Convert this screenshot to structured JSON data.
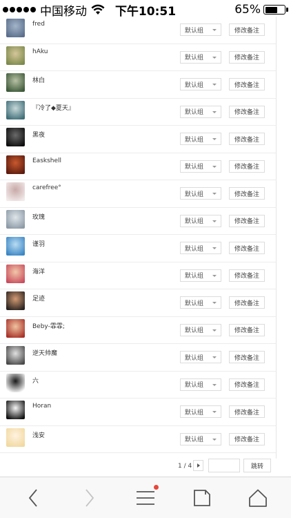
{
  "status_bar": {
    "carrier": "中国移动",
    "time": "下午10:51",
    "battery": "65%",
    "battery_level": 0.65
  },
  "friends": [
    {
      "name": "fred",
      "group": "默认组",
      "remark": "修改备注",
      "avatar_colors": [
        "#5a6e8c",
        "#a3b5c8"
      ]
    },
    {
      "name": "hAku",
      "group": "默认组",
      "remark": "修改备注",
      "avatar_colors": [
        "#7c8a4c",
        "#d5c69a"
      ]
    },
    {
      "name": "林白",
      "group": "默认组",
      "remark": "修改备注",
      "avatar_colors": [
        "#3e5a3a",
        "#b7c1a4"
      ]
    },
    {
      "name": "『冷了◆夏天』",
      "group": "默认组",
      "remark": "修改备注",
      "avatar_colors": [
        "#3f6e78",
        "#c6d8d8"
      ]
    },
    {
      "name": "黑夜",
      "group": "默认组",
      "remark": "修改备注",
      "avatar_colors": [
        "#0d0d0d",
        "#6a6a6a"
      ]
    },
    {
      "name": "Easkshell",
      "group": "默认组",
      "remark": "修改备注",
      "avatar_colors": [
        "#5c1c0e",
        "#c8582e"
      ]
    },
    {
      "name": "carefree°",
      "group": "默认组",
      "remark": "修改备注",
      "avatar_colors": [
        "#f2e9e9",
        "#c7aaa8"
      ]
    },
    {
      "name": "玫瑰",
      "group": "默认组",
      "remark": "修改备注",
      "avatar_colors": [
        "#8c9aa6",
        "#e0e6ea"
      ]
    },
    {
      "name": "谨羽",
      "group": "默认组",
      "remark": "修改备注",
      "avatar_colors": [
        "#3b86c4",
        "#b9dcf2"
      ]
    },
    {
      "name": "海洋",
      "group": "默认组",
      "remark": "修改备注",
      "avatar_colors": [
        "#c94e5e",
        "#f2c7a8"
      ]
    },
    {
      "name": "足迹",
      "group": "默认组",
      "remark": "修改备注",
      "avatar_colors": [
        "#2a2420",
        "#d39a74"
      ]
    },
    {
      "name": "Beby-霏霏;",
      "group": "默认组",
      "remark": "修改备注",
      "avatar_colors": [
        "#a8322a",
        "#f0c3a0"
      ]
    },
    {
      "name": "逆天帅魔",
      "group": "默认组",
      "remark": "修改备注",
      "avatar_colors": [
        "#4a4a4a",
        "#e0e0e0"
      ]
    },
    {
      "name": "六",
      "group": "默认组",
      "remark": "修改备注",
      "avatar_colors": [
        "#ffffff",
        "#1a1a1a"
      ]
    },
    {
      "name": "Horan",
      "group": "默认组",
      "remark": "修改备注",
      "avatar_colors": [
        "#111111",
        "#f5f5f5"
      ]
    },
    {
      "name": "浅安",
      "group": "默认组",
      "remark": "修改备注",
      "avatar_colors": [
        "#f1d9a0",
        "#fff2e0"
      ]
    }
  ],
  "pagination": {
    "page_info": "1 / 4",
    "jump_label": "跳转",
    "jump_value": ""
  },
  "toolbar": {
    "icons": [
      "back-arrow-icon",
      "forward-arrow-icon",
      "menu-icon",
      "tabs-icon",
      "home-icon"
    ],
    "menu_has_badge": true,
    "badge_color": "#e8463c"
  }
}
